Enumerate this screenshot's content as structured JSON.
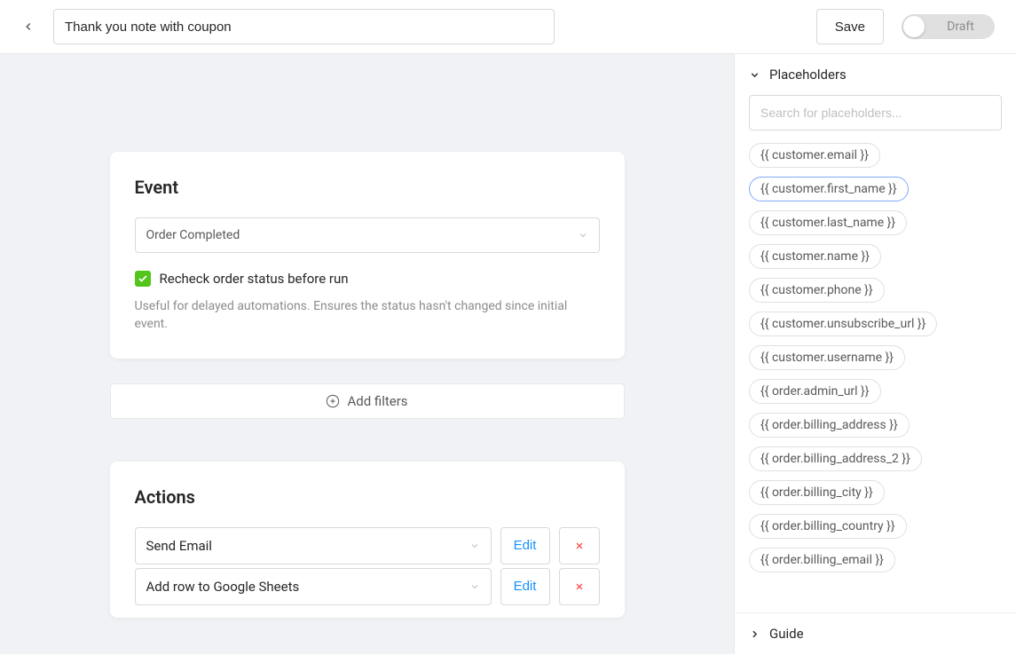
{
  "header": {
    "title_value": "Thank you note with coupon",
    "save_label": "Save",
    "draft_label": "Draft"
  },
  "event_card": {
    "title": "Event",
    "select_value": "Order Completed",
    "checkbox_checked": true,
    "checkbox_label": "Recheck order status before run",
    "help_text": "Useful for delayed automations. Ensures the status hasn't changed since initial event."
  },
  "add_filters_label": "Add filters",
  "actions_card": {
    "title": "Actions",
    "edit_label": "Edit",
    "rows": [
      {
        "label": "Send Email"
      },
      {
        "label": "Add row to Google Sheets"
      }
    ]
  },
  "sidebar": {
    "placeholders_title": "Placeholders",
    "search_placeholder": "Search for placeholders...",
    "guide_title": "Guide",
    "placeholders": [
      "{{ customer.email }}",
      "{{ customer.first_name }}",
      "{{ customer.last_name }}",
      "{{ customer.name }}",
      "{{ customer.phone }}",
      "{{ customer.unsubscribe_url }}",
      "{{ customer.username }}",
      "{{ order.admin_url }}",
      "{{ order.billing_address }}",
      "{{ order.billing_address_2 }}",
      "{{ order.billing_city }}",
      "{{ order.billing_country }}",
      "{{ order.billing_email }}"
    ],
    "selected_index": 1
  }
}
